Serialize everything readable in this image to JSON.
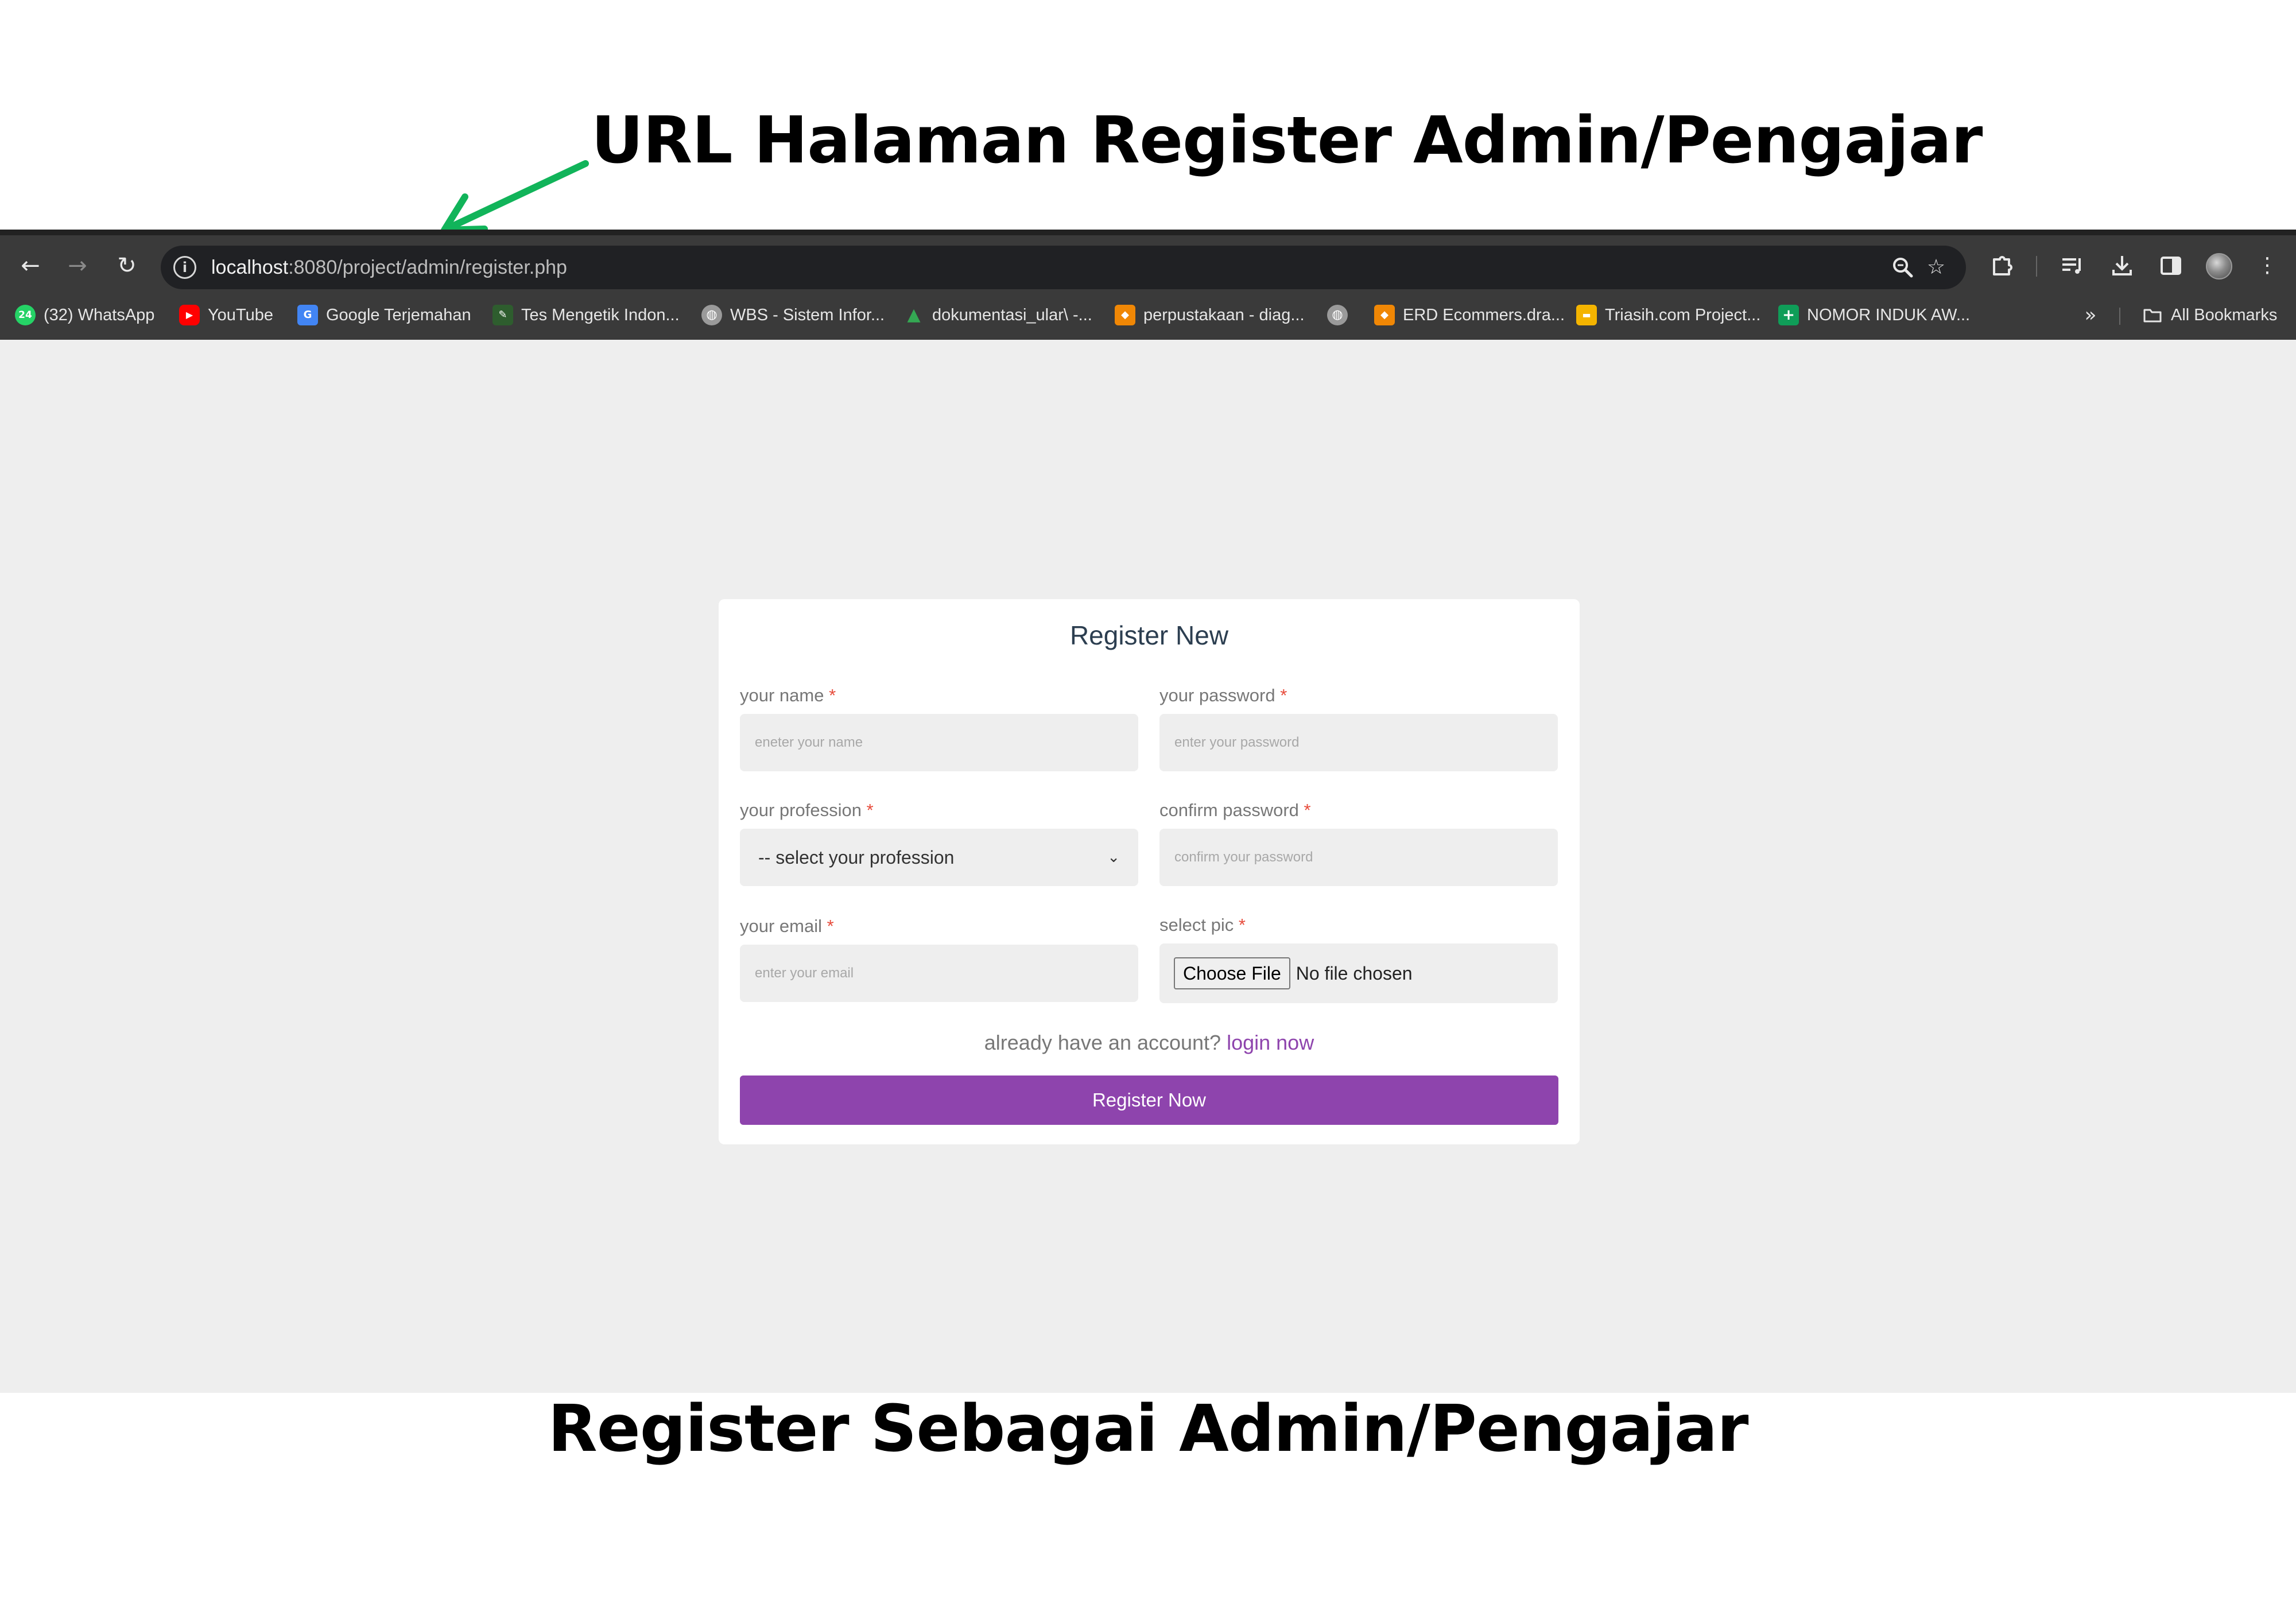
{
  "captions": {
    "top": "URL Halaman Register Admin/Pengajar",
    "bottom": "Register Sebagai Admin/Pengajar",
    "arrow_color": "#11b45a"
  },
  "browser": {
    "url_host": "localhost",
    "url_rest": ":8080/project/admin/register.php",
    "bookmarks": [
      {
        "label": "(32) WhatsApp",
        "icon": "whatsapp-icon",
        "badge": "24"
      },
      {
        "label": "YouTube",
        "icon": "youtube-icon"
      },
      {
        "label": "Google Terjemahan",
        "icon": "google-translate-icon"
      },
      {
        "label": "Tes Mengetik Indon...",
        "icon": "typing-test-icon"
      },
      {
        "label": "WBS - Sistem Infor...",
        "icon": "globe-icon"
      },
      {
        "label": "dokumentasi_ular\\ -...",
        "icon": "google-drive-icon"
      },
      {
        "label": "perpustakaan - diag...",
        "icon": "drawio-icon"
      },
      {
        "label": "",
        "icon": "globe-icon"
      },
      {
        "label": "ERD Ecommers.dra...",
        "icon": "drawio-icon"
      },
      {
        "label": "Triasih.com Project...",
        "icon": "google-slides-icon"
      },
      {
        "label": "NOMOR INDUK AW...",
        "icon": "google-sheets-icon"
      }
    ],
    "all_bookmarks": "All Bookmarks"
  },
  "form": {
    "title": "Register New",
    "required_mark": "*",
    "name": {
      "label": "your name",
      "placeholder": "eneter your name"
    },
    "password": {
      "label": "your password",
      "placeholder": "enter your password"
    },
    "profession": {
      "label": "your profession",
      "selected": "-- select your profession"
    },
    "confirm": {
      "label": "confirm password",
      "placeholder": "confirm your password"
    },
    "email": {
      "label": "your email",
      "placeholder": "enter your email"
    },
    "pic": {
      "label": "select pic",
      "button": "Choose File",
      "status": "No file chosen"
    },
    "login_prompt": "already have an account?",
    "login_link": "login now",
    "submit": "Register Now"
  },
  "colors": {
    "accent": "#8e44ad",
    "required": "#e74c3c",
    "page_background": "#eeeeee",
    "chrome_dark": "#3a3a3a"
  }
}
